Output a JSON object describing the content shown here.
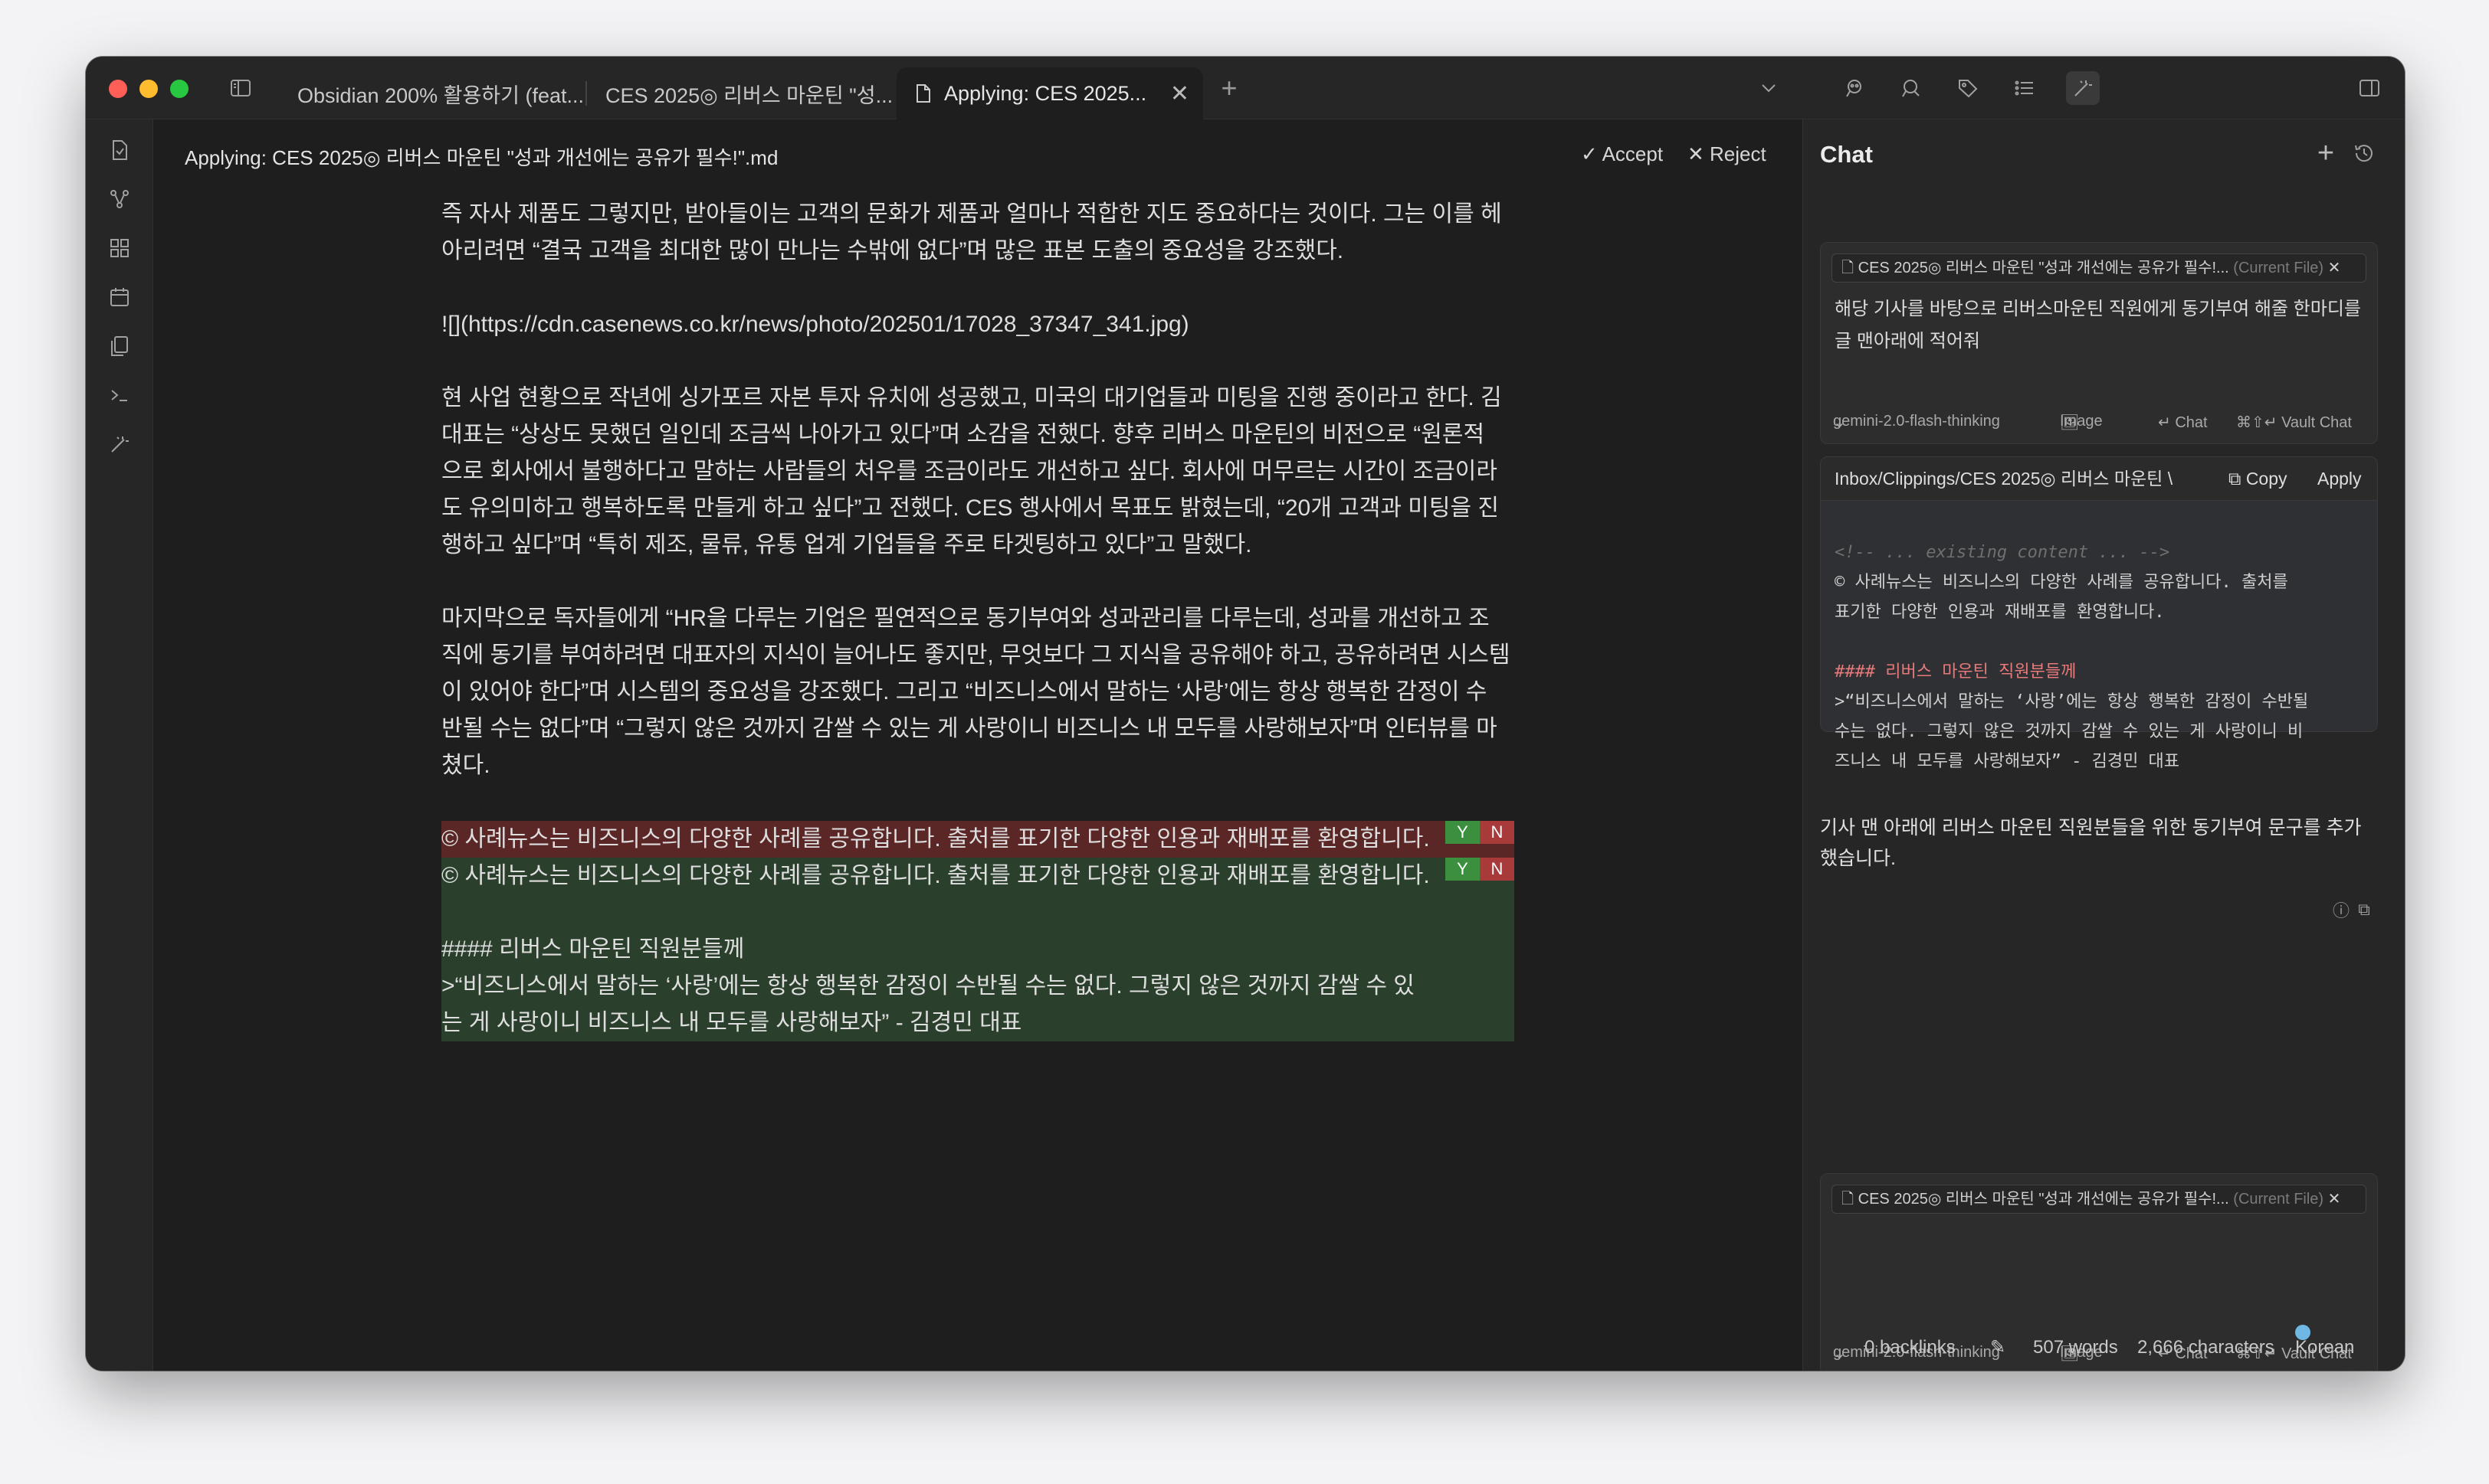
{
  "tabs": [
    {
      "label": "Obsidian 200% 활용하기 (feat..."
    },
    {
      "label": "CES 2025◎ 리버스 마운틴 \"성..."
    },
    {
      "label": "Applying: CES 2025..."
    }
  ],
  "editor": {
    "file_title": "Applying: CES 2025◎ 리버스 마운틴 \"성과 개선에는 공유가 필수!\".md",
    "accept_label": "Accept",
    "reject_label": "Reject",
    "paragraphs": [
      [
        "즉 자사 제품도 그렇지만, 받아들이는 고객의 문화가 제품과 얼마나 적합한 지도 중요하다는 것이다. 그는 이를 헤",
        "아리려면 “결국 고객을 최대한 많이 만나는 수밖에 없다”며 많은 표본 도출의 중요성을 강조했다."
      ],
      [
        "![](https://cdn.casenews.co.kr/news/photo/202501/17028_37347_341.jpg)"
      ],
      [
        "현 사업 현황으로 작년에 싱가포르 자본 투자 유치에 성공했고, 미국의 대기업들과 미팅을 진행 중이라고 한다. 김",
        "대표는 “상상도 못했던 일인데 조금씩 나아가고 있다”며 소감을 전했다. 향후 리버스 마운틴의 비전으로 “원론적",
        "으로 회사에서 불행하다고 말하는 사람들의 처우를 조금이라도 개선하고 싶다. 회사에 머무르는 시간이 조금이라",
        "도 유의미하고 행복하도록 만들게 하고 싶다”고 전했다. CES 행사에서 목표도 밝혔는데, “20개 고객과 미팅을 진",
        "행하고 싶다”며 “특히 제조, 물류, 유통 업계 기업들을 주로 타겟팅하고 있다”고 말했다."
      ],
      [
        "마지막으로 독자들에게 “HR을 다루는 기업은 필연적으로 동기부여와 성과관리를 다루는데, 성과를 개선하고 조",
        "직에 동기를 부여하려면 대표자의 지식이 늘어나도 좋지만, 무엇보다 그 지식을 공유해야 하고, 공유하려면 시스템",
        "이 있어야 한다”며 시스템의 중요성을 강조했다. 그리고 “비즈니스에서 말하는 ‘사랑’에는 항상 행복한 감정이 수",
        "반될 수는 없다”며 “그렇지 않은 것까지 감쌀 수 있는 게 사랑이니 비즈니스 내 모두를 사랑해보자”며 인터뷰를 마",
        "쳤다."
      ]
    ],
    "diff_removed": "© 사례뉴스는 비즈니스의 다양한 사례를 공유합니다. 출처를 표기한 다양한 인용과 재배포를 환영합니다.",
    "diff_added": "© 사례뉴스는 비즈니스의 다양한 사례를 공유합니다. 출처를 표기한 다양한 인용과 재배포를 환영합니다.",
    "diff_added_block": [
      "",
      "#### 리버스 마운틴 직원분들께",
      ">“비즈니스에서 말하는 ‘사랑’에는 항상 행복한 감정이 수반될 수는 없다. 그렇지 않은 것까지 감쌀 수 있",
      "는 게 사랑이니 비즈니스 내 모두를 사랑해보자” - 김경민 대표"
    ],
    "yes_label": "Y",
    "no_label": "N"
  },
  "chat": {
    "title": "Chat",
    "context_chip": "CES 2025◎ 리버스 마운틴 \"성과 개선에는 공유가 필수!...",
    "current_file_tag": "(Current File)",
    "user_message": "해당 기사를 바탕으로 리버스마운틴 직원에게 동기부여 해줄 한마디를 글 맨아래에 적어줘",
    "model": "gemini-2.0-flash-thinking",
    "image_label": "Image",
    "chat_label": "↵ Chat",
    "vault_chat_label": "⌘⇧↵ Vault Chat",
    "code_path": "Inbox/Clippings/CES 2025◎ 리버스 마운틴 \\",
    "copy_label": "Copy",
    "apply_label": "Apply",
    "code_lines": [
      {
        "text": "<!-- ... existing content ... -->",
        "kind": "comment"
      },
      {
        "text": "© 사례뉴스는 비즈니스의 다양한 사례를 공유합니다. 출처를",
        "kind": "text"
      },
      {
        "text": "표기한 다양한 인용과 재배포를 환영합니다.",
        "kind": "text"
      },
      {
        "text": "",
        "kind": "text"
      },
      {
        "text": "#### 리버스 마운틴 직원분들께",
        "kind": "heading"
      },
      {
        "text": ">“비즈니스에서 말하는 ‘사랑’에는 항상 행복한 감정이 수반될",
        "kind": "text"
      },
      {
        "text": "수는 없다. 그렇지 않은 것까지 감쌀 수 있는 게 사랑이니 비",
        "kind": "text"
      },
      {
        "text": "즈니스 내 모두를 사랑해보자” - 김경민 대표",
        "kind": "text"
      }
    ],
    "assistant_reply": "기사 맨 아래에 리버스 마운틴 직원분들을 위한 동기부여 문구를 추가했습니다.",
    "input_placeholder": ""
  },
  "status": {
    "backlinks": "0 backlinks",
    "words": "507 words",
    "characters": "2,666 characters",
    "language": "Korean"
  },
  "colors": {
    "diff_removed_bg": "#5a2626",
    "diff_added_bg": "#2a3f2c",
    "accept_green": "#3b8f3e",
    "reject_red": "#a83a3a"
  }
}
